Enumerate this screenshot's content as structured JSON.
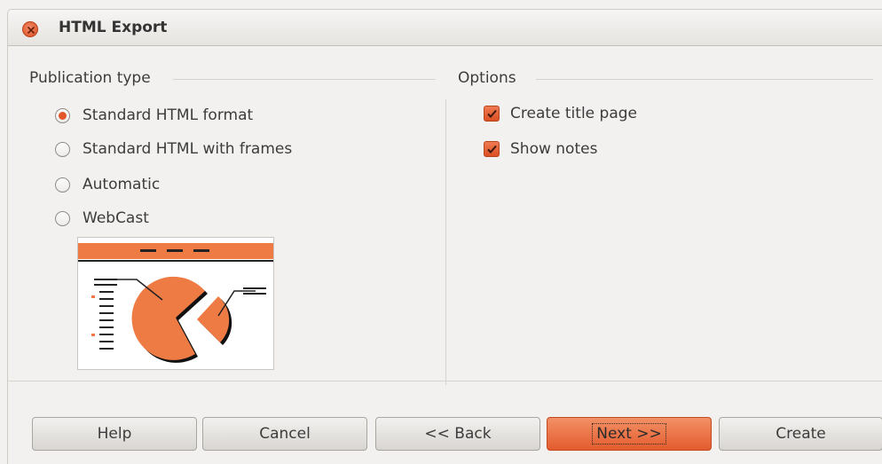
{
  "window": {
    "title": "HTML Export"
  },
  "publication": {
    "title": "Publication type",
    "options": [
      {
        "label": "Standard HTML format",
        "checked": true
      },
      {
        "label": "Standard HTML with frames",
        "checked": false
      },
      {
        "label": "Automatic",
        "checked": false
      },
      {
        "label": "WebCast",
        "checked": false
      }
    ]
  },
  "options": {
    "title": "Options",
    "checkboxes": [
      {
        "label": "Create title page",
        "checked": true
      },
      {
        "label": "Show notes",
        "checked": true
      }
    ]
  },
  "buttons": {
    "help": "Help",
    "cancel": "Cancel",
    "back": "<< Back",
    "next": "Next >>",
    "create": "Create"
  },
  "colors": {
    "accent": "#e35c2e",
    "preview_orange": "#ee7b44"
  }
}
